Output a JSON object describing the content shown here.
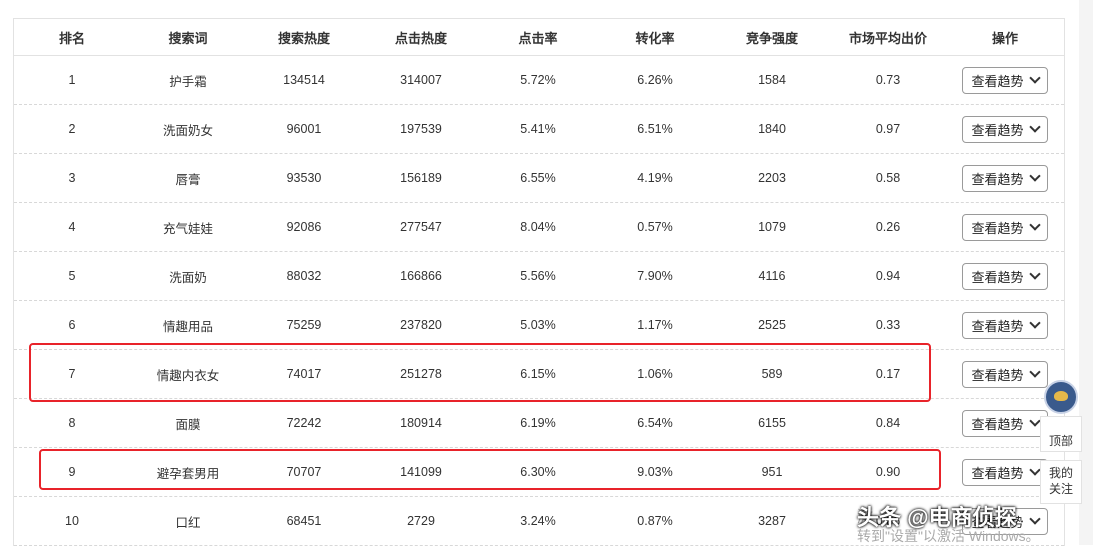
{
  "header_cells": [
    "排名",
    "搜索词",
    "搜索热度",
    "点击热度",
    "点击率",
    "转化率",
    "竞争强度",
    "市场平均出价",
    "操作"
  ],
  "action_label": "查看趋势",
  "rows": [
    {
      "rank": "1",
      "keyword": "护手霜",
      "search": "134514",
      "click": "314007",
      "ctr": "5.72%",
      "cvr": "6.26%",
      "comp": "1584",
      "price": "0.73"
    },
    {
      "rank": "2",
      "keyword": "洗面奶女",
      "search": "96001",
      "click": "197539",
      "ctr": "5.41%",
      "cvr": "6.51%",
      "comp": "1840",
      "price": "0.97"
    },
    {
      "rank": "3",
      "keyword": "唇膏",
      "search": "93530",
      "click": "156189",
      "ctr": "6.55%",
      "cvr": "4.19%",
      "comp": "2203",
      "price": "0.58"
    },
    {
      "rank": "4",
      "keyword": "充气娃娃",
      "search": "92086",
      "click": "277547",
      "ctr": "8.04%",
      "cvr": "0.57%",
      "comp": "1079",
      "price": "0.26"
    },
    {
      "rank": "5",
      "keyword": "洗面奶",
      "search": "88032",
      "click": "166866",
      "ctr": "5.56%",
      "cvr": "7.90%",
      "comp": "4116",
      "price": "0.94"
    },
    {
      "rank": "6",
      "keyword": "情趣用品",
      "search": "75259",
      "click": "237820",
      "ctr": "5.03%",
      "cvr": "1.17%",
      "comp": "2525",
      "price": "0.33"
    },
    {
      "rank": "7",
      "keyword": "情趣内衣女",
      "search": "74017",
      "click": "251278",
      "ctr": "6.15%",
      "cvr": "1.06%",
      "comp": "589",
      "price": "0.17"
    },
    {
      "rank": "8",
      "keyword": "面膜",
      "search": "72242",
      "click": "180914",
      "ctr": "6.19%",
      "cvr": "6.54%",
      "comp": "6155",
      "price": "0.84"
    },
    {
      "rank": "9",
      "keyword": "避孕套男用",
      "search": "70707",
      "click": "141099",
      "ctr": "6.30%",
      "cvr": "9.03%",
      "comp": "951",
      "price": "0.90"
    },
    {
      "rank": "10",
      "keyword": "口红",
      "search": "68451",
      "click": "2729",
      "ctr": "3.24%",
      "cvr": "0.87%",
      "comp": "3287",
      "price": "0.86"
    }
  ],
  "widget": {
    "top_label": "顶部",
    "follow_label_1": "我的",
    "follow_label_2": "关注"
  },
  "watermark": "头条 @电商侦探",
  "activate_line1": "激",
  "activate_line2": "转到\"设置\"以激活 Windows。",
  "accent_color": "#e8232a"
}
